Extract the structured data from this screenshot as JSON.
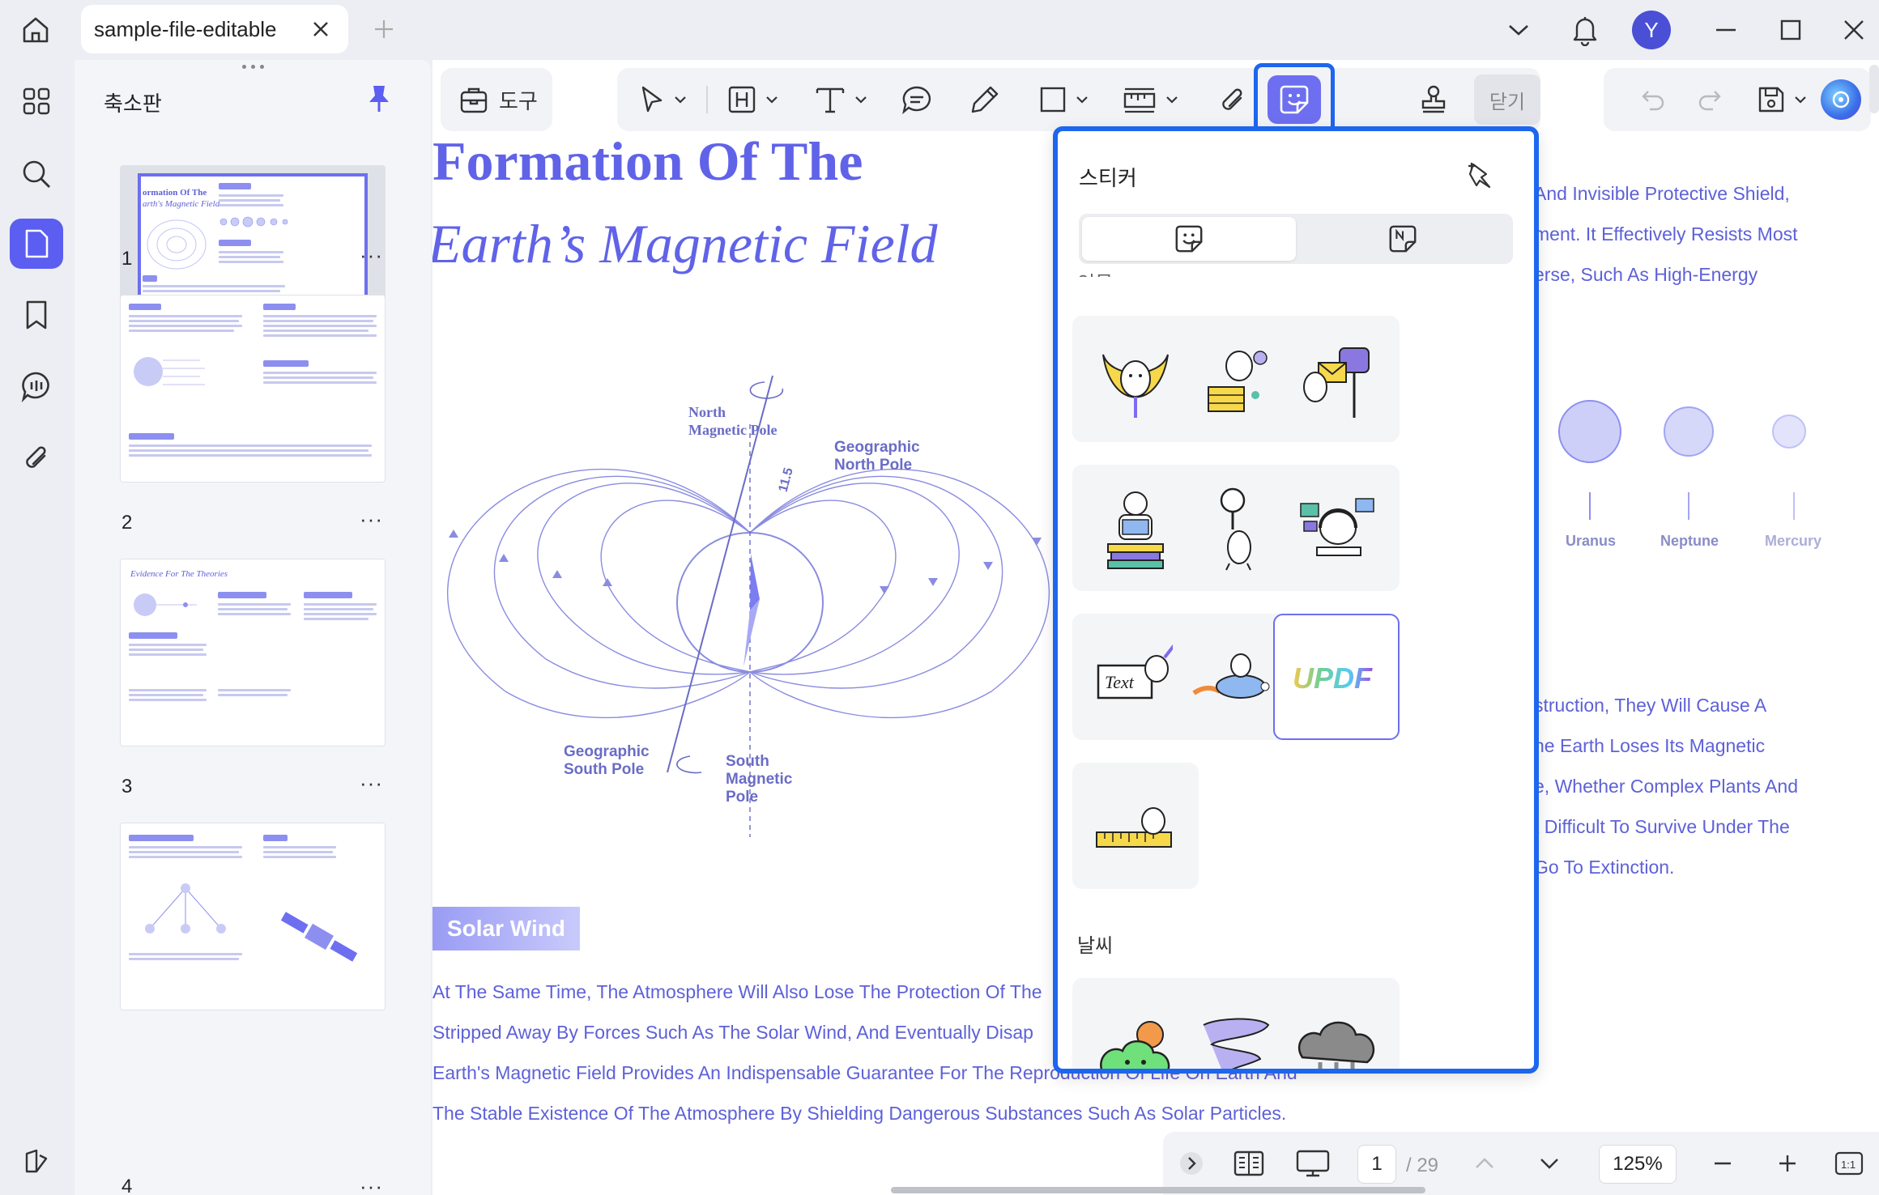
{
  "tab": {
    "title": "sample-file-editable"
  },
  "user": {
    "initial": "Y"
  },
  "thumbnails": {
    "title": "축소판",
    "pages": [
      {
        "number": "1",
        "more": "···"
      },
      {
        "number": "2",
        "more": "···"
      },
      {
        "number": "3",
        "more": "···"
      },
      {
        "number": "4",
        "more": "···"
      }
    ],
    "page1": {
      "title_line1": "ormation Of The",
      "title_line2": "arth's Magnetic Field"
    },
    "page3": {
      "title": "Evidence For The Theories"
    }
  },
  "toolbar": {
    "tools_label": "도구",
    "close_label": "닫기"
  },
  "sticker_panel": {
    "title": "스티커",
    "category_clipped": "인물",
    "category_weather": "날씨",
    "selected_sticker_text": "UPDF",
    "sticker_text_board": "Text"
  },
  "document": {
    "title_line1": "Formation Of The",
    "title_line2": "Earth’s Magnetic Field",
    "diagram": {
      "north_magnetic": [
        "North",
        "Magnetic Pole"
      ],
      "geo_north": [
        "Geographic",
        "North Pole"
      ],
      "geo_south": [
        "Geographic",
        "South Pole"
      ],
      "south_magnetic": [
        "South",
        "Magnetic",
        "Pole"
      ],
      "angle": "11.5"
    },
    "section_tag": "Solar Wind",
    "paragraph": [
      "At The Same Time, The Atmosphere Will Also Lose The Protection Of The",
      "Stripped Away By Forces Such As The Solar Wind, And Eventually Disap",
      "Earth's Magnetic Field Provides An Indispensable Guarantee For The Reproduction Of Life On Earth And",
      "The Stable Existence Of The Atmosphere By Shielding Dangerous Substances Such As Solar Particles."
    ],
    "right_top": [
      "And Invisible Protective Shield,",
      "ment. It Effectively Resists Most",
      "erse, Such As High-Energy"
    ],
    "planets": [
      "Uranus",
      "Neptune",
      "Mercury"
    ],
    "right_bottom": [
      "struction, They Will Cause A",
      "he Earth Loses Its Magnetic",
      "e, Whether Complex Plants And",
      "t Difficult To Survive Under The",
      "Go To Extinction."
    ]
  },
  "status": {
    "current_page": "1",
    "total_pages": "/ 29",
    "zoom": "125%",
    "fit_label": "1:1"
  },
  "colors": {
    "accent": "#5b5ef0",
    "highlight": "#1d66ee",
    "doc_text": "#5e61d8"
  }
}
